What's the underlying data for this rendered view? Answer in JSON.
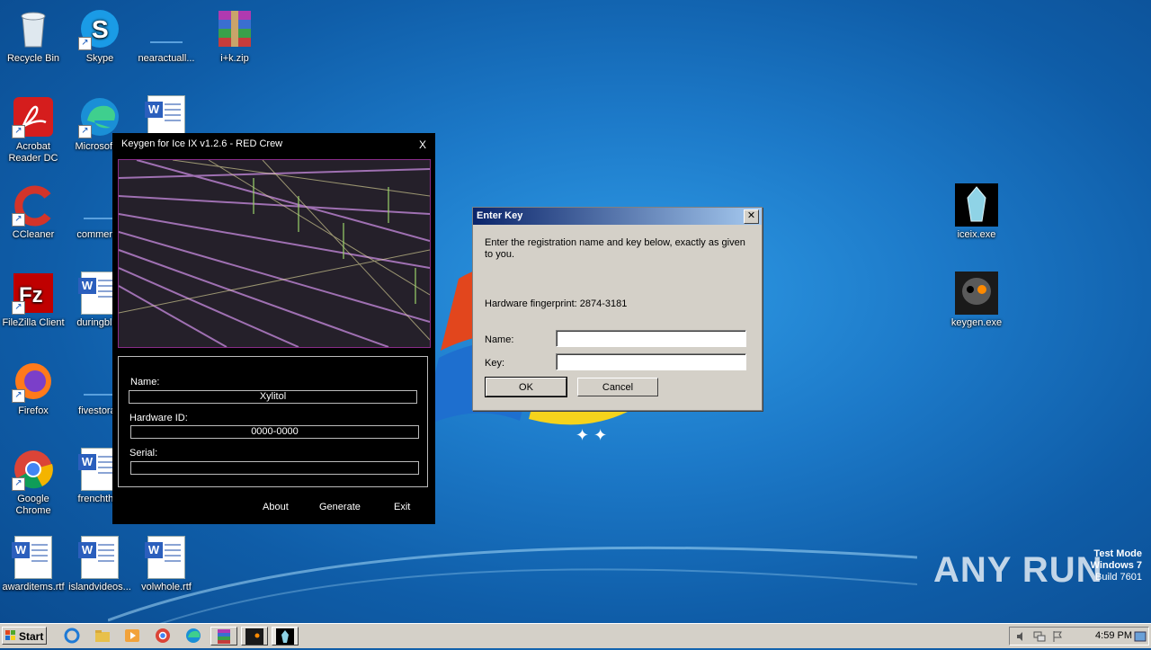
{
  "desktop": {
    "icons": [
      {
        "label": "Recycle Bin"
      },
      {
        "label": "Skype"
      },
      {
        "label": "nearactuall..."
      },
      {
        "label": "i+k.zip"
      },
      {
        "label": "Acrobat Reader DC"
      },
      {
        "label": "Microsoft E"
      },
      {
        "label": "CCleaner"
      },
      {
        "label": "commerce"
      },
      {
        "label": "FileZilla Client"
      },
      {
        "label": "duringblue"
      },
      {
        "label": "Firefox"
      },
      {
        "label": "fivestorag"
      },
      {
        "label": "Google Chrome"
      },
      {
        "label": "frenchthat"
      },
      {
        "label": "awarditems.rtf"
      },
      {
        "label": "islandvideos..."
      },
      {
        "label": "volwhole.rtf"
      },
      {
        "label": "iceix.exe"
      },
      {
        "label": "keygen.exe"
      }
    ]
  },
  "keygen": {
    "title": "Keygen for Ice IX v1.2.6 - RED Crew",
    "close": "X",
    "name_label": "Name:",
    "name_value": "Xylitol",
    "hwid_label": "Hardware ID:",
    "hwid_value": "0000-0000",
    "serial_label": "Serial:",
    "serial_value": "",
    "about": "About",
    "generate": "Generate",
    "exit": "Exit"
  },
  "dialog": {
    "title": "Enter Key",
    "instruction": "Enter the registration name and key below, exactly as given to you.",
    "fingerprint": "Hardware fingerprint: 2874-3181",
    "name_label": "Name:",
    "key_label": "Key:",
    "name_value": "",
    "key_value": "",
    "ok": "OK",
    "cancel": "Cancel"
  },
  "taskbar": {
    "start": "Start",
    "clock": "4:59 PM"
  },
  "watermark": {
    "line1": "Test Mode",
    "line2": "Windows 7",
    "line3": "Build 7601",
    "brand": "ANY RUN"
  },
  "colors": {
    "wallpaper": "#1c79c8",
    "dialog_title_from": "#0a246a",
    "dialog_title_to": "#a6caf0",
    "window_face": "#d4d0c8"
  }
}
